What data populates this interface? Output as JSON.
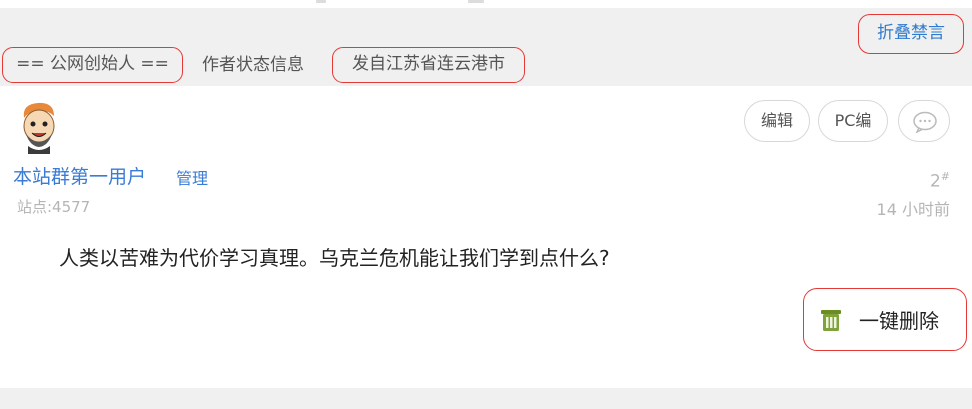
{
  "header": {
    "fold_label": "折叠禁言",
    "author_tag": "== 公网创始人 ==",
    "status_info": "作者状态信息",
    "location": "发自江苏省连云港市"
  },
  "toolbar": {
    "edit_label": "编辑",
    "pc_edit_label": "PC编",
    "comment_icon": "speech-bubble-icon"
  },
  "post": {
    "username": "本站群第一用户",
    "role": "管理",
    "site_score": "站点:4577",
    "floor_number": "2",
    "floor_mark": "#",
    "time": "14 小时前",
    "content": "人类以苦难为代价学习真理。乌克兰危机能让我们学到点什么?"
  },
  "actions": {
    "delete_label": "一键删除",
    "delete_icon": "trash-icon"
  },
  "colors": {
    "accent_blue": "#3a7bd5",
    "highlight_red": "#e53935",
    "trash_green": "#6b8e23"
  }
}
